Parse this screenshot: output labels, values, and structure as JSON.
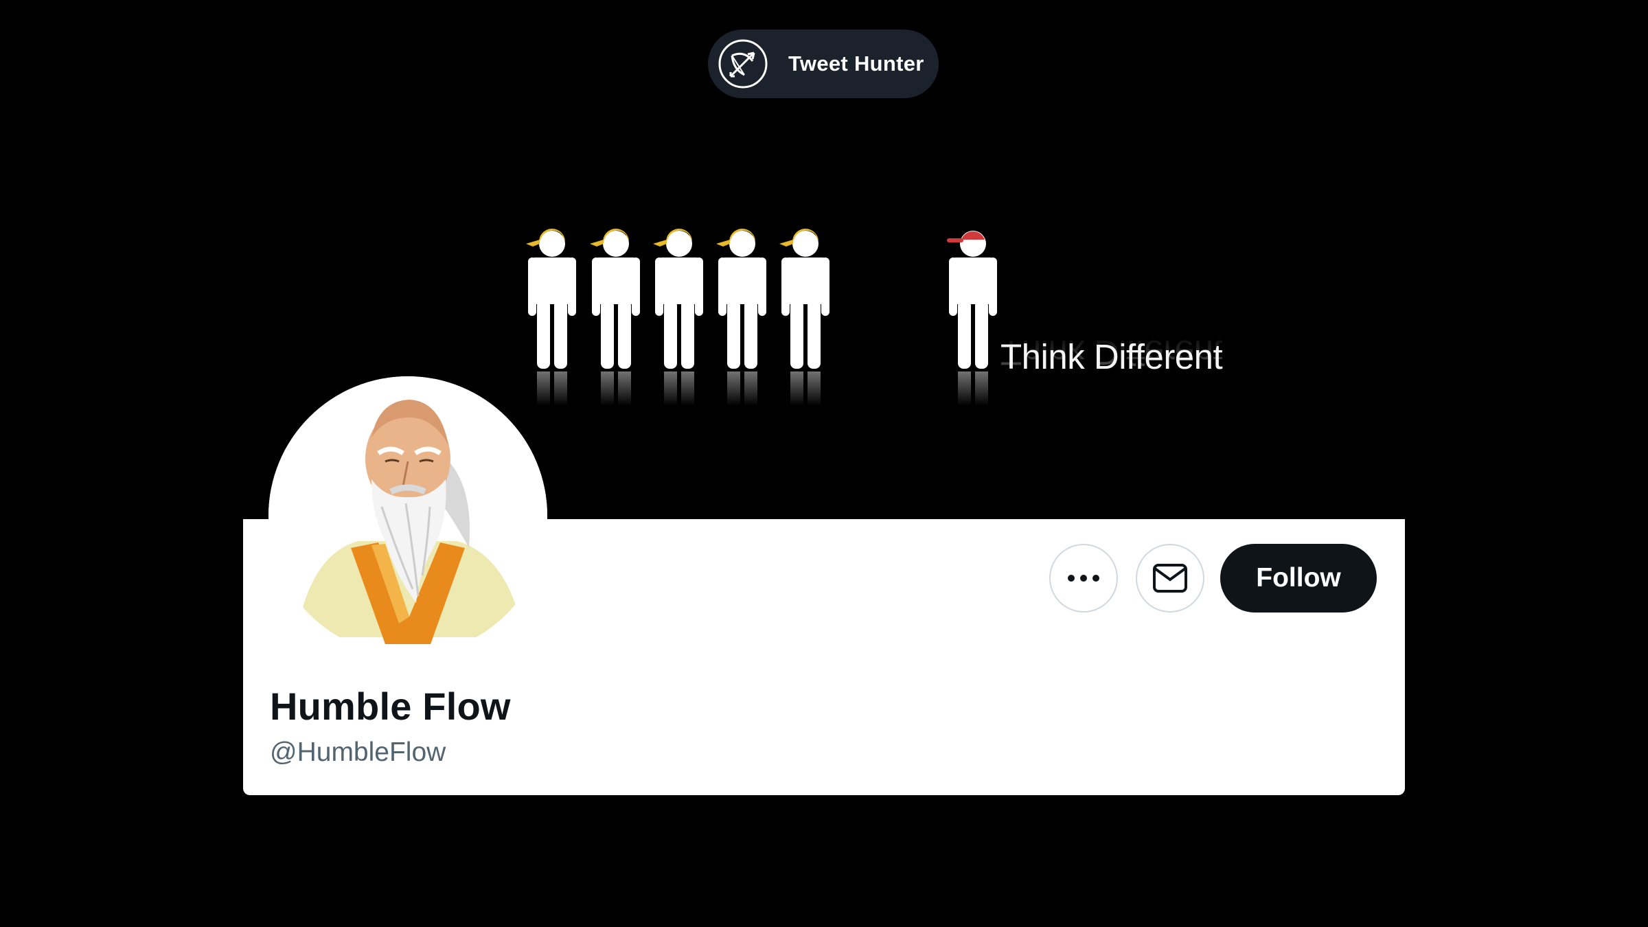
{
  "brand": {
    "name": "Tweet Hunter",
    "icon": "bow-and-arrow-icon"
  },
  "banner": {
    "tagline": "Think Different",
    "icons": [
      "conformist-figure-icon",
      "different-figure-icon"
    ]
  },
  "profile": {
    "display_name": "Humble Flow",
    "handle": "@HumbleFlow",
    "avatar": "sage-portrait-avatar"
  },
  "actions": {
    "more_icon": "more-options-icon",
    "message_icon": "envelope-icon",
    "follow_label": "Follow"
  },
  "colors": {
    "background": "#000000",
    "pill": "#1c222b",
    "follow_button": "#0f1419",
    "handle_text": "#536471",
    "figure_helmet": "#e7b92a",
    "odd_cap": "#d03a3a"
  }
}
